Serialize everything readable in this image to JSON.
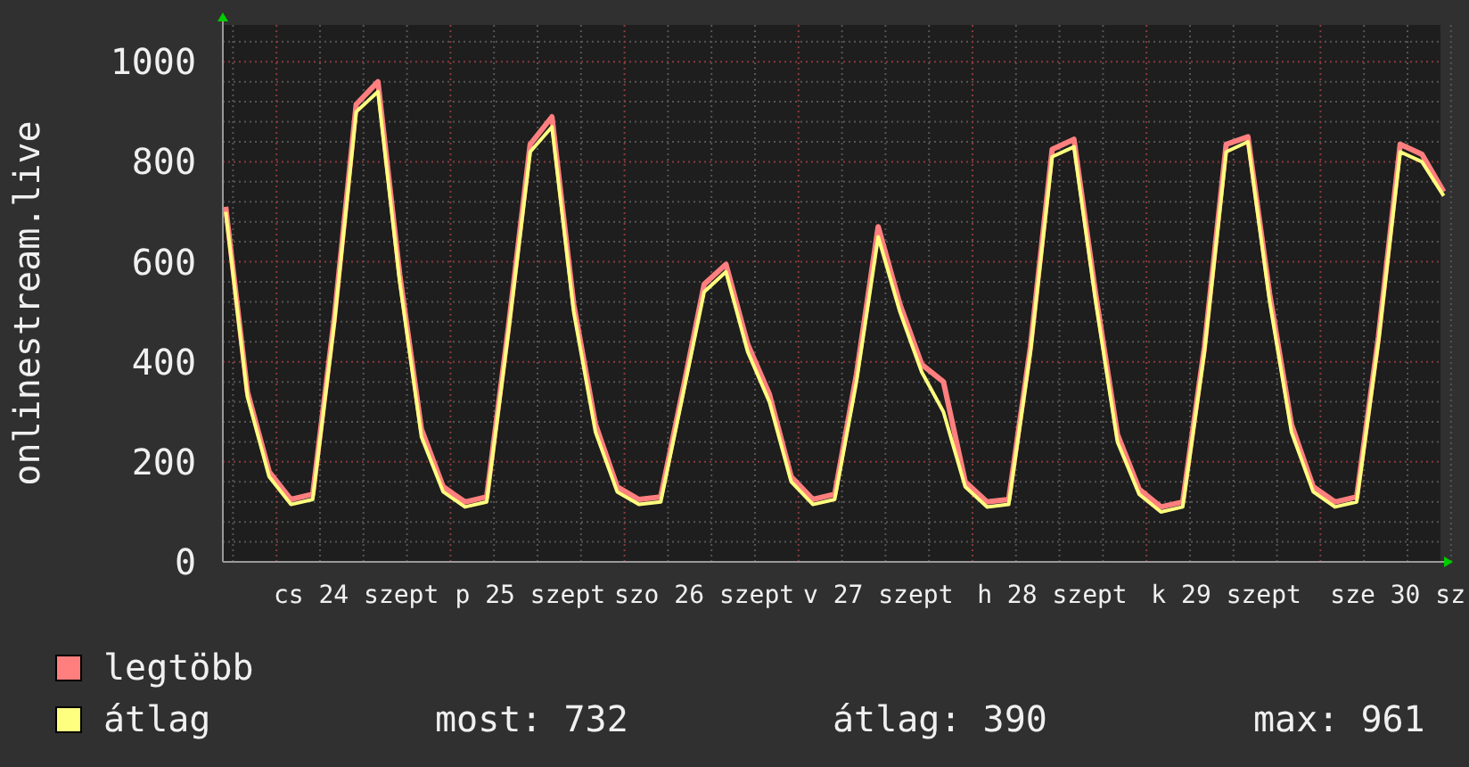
{
  "chart": {
    "y_axis_label": "onlinestream.live",
    "chart_data": {
      "type": "line",
      "categories": [
        null,
        null,
        null,
        null,
        null,
        null,
        "cs 24 szept",
        null,
        null,
        null,
        null,
        null,
        null,
        null,
        "p 25 szept",
        null,
        null,
        null,
        null,
        null,
        null,
        null,
        "szo 26 szept",
        null,
        null,
        null,
        null,
        null,
        null,
        null,
        "v 27 szept",
        null,
        null,
        null,
        null,
        null,
        null,
        null,
        "h 28 szept",
        null,
        null,
        null,
        null,
        null,
        null,
        null,
        "k 29 szept",
        null,
        null,
        null,
        null,
        null,
        null,
        null,
        "sze 30 sz",
        null,
        null
      ],
      "series": [
        {
          "name": "legtöbb",
          "color": "#ff7f7f",
          "values": [
            710,
            340,
            180,
            125,
            135,
            490,
            915,
            960,
            575,
            265,
            150,
            120,
            130,
            470,
            835,
            890,
            515,
            275,
            150,
            125,
            130,
            340,
            555,
            595,
            435,
            335,
            170,
            125,
            135,
            375,
            670,
            515,
            395,
            360,
            160,
            120,
            125,
            430,
            825,
            845,
            535,
            255,
            145,
            110,
            120,
            430,
            835,
            850,
            535,
            275,
            150,
            120,
            130,
            450,
            835,
            815,
            740
          ]
        },
        {
          "name": "átlag",
          "color": "#ffff7f",
          "values": [
            700,
            330,
            170,
            115,
            125,
            480,
            900,
            940,
            560,
            250,
            140,
            110,
            120,
            460,
            820,
            870,
            500,
            260,
            140,
            115,
            120,
            330,
            540,
            580,
            420,
            320,
            160,
            115,
            125,
            360,
            650,
            500,
            380,
            300,
            150,
            110,
            115,
            420,
            810,
            830,
            520,
            240,
            135,
            100,
            110,
            420,
            820,
            840,
            520,
            260,
            140,
            110,
            120,
            440,
            820,
            800,
            732
          ]
        }
      ],
      "grid": true,
      "ylim": [
        0,
        1070
      ],
      "yticks": [
        0,
        200,
        400,
        600,
        800,
        1000
      ]
    }
  },
  "stats": [
    "most: 732",
    "átlag: 390",
    "max: 961"
  ]
}
